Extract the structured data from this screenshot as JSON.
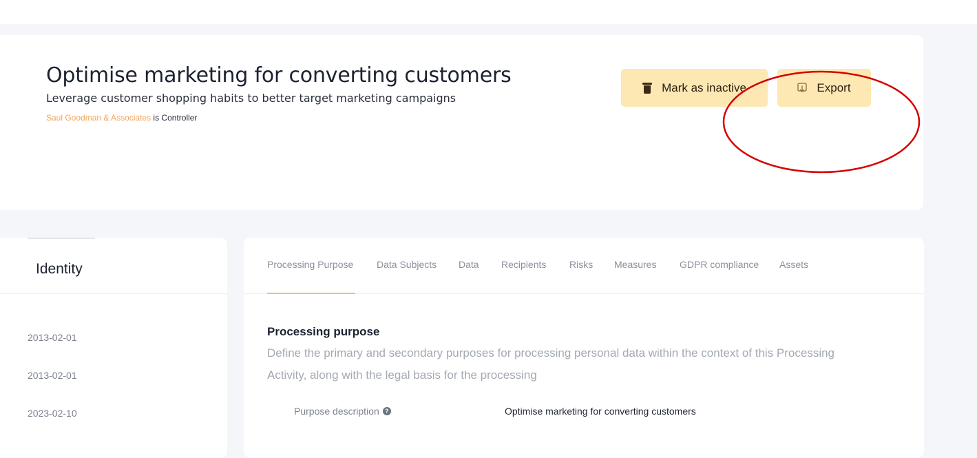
{
  "header": {
    "title": "Optimise marketing for converting customers",
    "subtitle": "Leverage customer shopping habits to better target marketing campaigns",
    "controller_org": "Saul Goodman & Associates",
    "controller_suffix": " is Controller",
    "actions": {
      "mark_inactive": "Mark as inactive",
      "export": "Export"
    }
  },
  "sidebar": {
    "title": "Identity",
    "dates": [
      "2013-02-01",
      "2013-02-01",
      "2023-02-10"
    ]
  },
  "tabs": [
    {
      "label": "Processing Purpose",
      "active": true
    },
    {
      "label": "Data Subjects"
    },
    {
      "label": "Data"
    },
    {
      "label": "Recipients"
    },
    {
      "label": "Risks"
    },
    {
      "label": "Measures"
    },
    {
      "label": "GDPR compliance"
    },
    {
      "label": "Assets"
    }
  ],
  "section": {
    "title": "Processing purpose",
    "description": "Define the primary and secondary purposes for processing personal data within the context of this Processing Activity, along with the legal basis for the processing",
    "fields": [
      {
        "label": "Purpose description",
        "value": "Optimise marketing for converting customers"
      }
    ]
  },
  "colors": {
    "accent": "#f4a45c",
    "button_bg": "#fde8b4",
    "annotation": "#d40000",
    "tab_underline": "#f1bf6a"
  },
  "icons": {
    "mark_inactive": "trash-icon",
    "export": "download-icon",
    "help": "question-icon"
  }
}
